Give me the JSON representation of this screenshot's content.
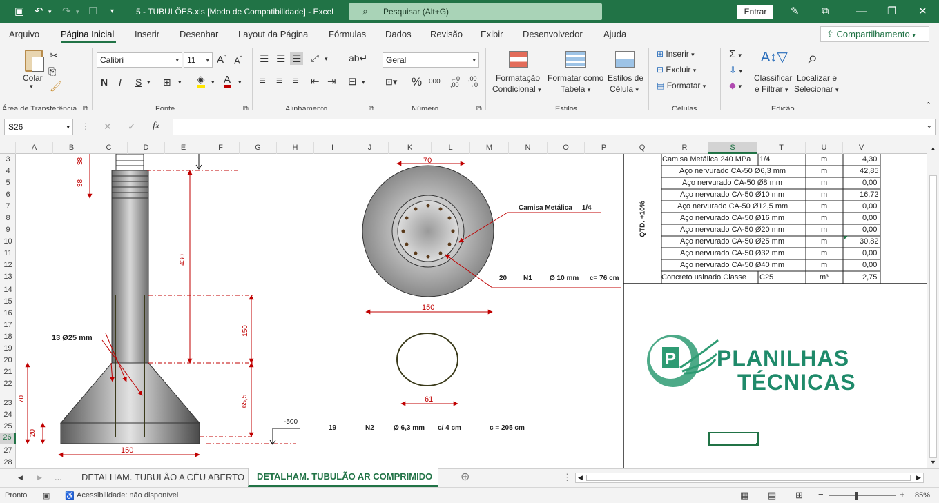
{
  "titlebar": {
    "title": "5 - TUBULÕES.xls  [Modo de Compatibilidade]  -  Excel",
    "search": "Pesquisar (Alt+G)",
    "signin": "Entrar"
  },
  "menu": {
    "tabs": [
      "Arquivo",
      "Página Inicial",
      "Inserir",
      "Desenhar",
      "Layout da Página",
      "Fórmulas",
      "Dados",
      "Revisão",
      "Exibir",
      "Desenvolvedor",
      "Ajuda"
    ],
    "active": "Página Inicial",
    "share": "Compartilhamento"
  },
  "ribbon": {
    "clipboard": {
      "paste": "Colar",
      "group": "Área de Transferência"
    },
    "font": {
      "name": "Calibri",
      "size": "11",
      "group": "Fonte",
      "bold": "N",
      "italic": "I",
      "underline": "S"
    },
    "alignment": {
      "group": "Alinhamento"
    },
    "number": {
      "format": "Geral",
      "group": "Número",
      "percent": "%",
      "thousands": "000"
    },
    "styles": {
      "cond1": "Formatação",
      "cond2": "Condicional",
      "table1": "Formatar como",
      "table2": "Tabela",
      "cell1": "Estilos de",
      "cell2": "Célula",
      "group": "Estilos"
    },
    "cells": {
      "insert": "Inserir",
      "delete": "Excluir",
      "format": "Formatar",
      "group": "Células"
    },
    "editing": {
      "sort1": "Classificar",
      "sort2": "e Filtrar",
      "find1": "Localizar e",
      "find2": "Selecionar",
      "group": "Edição"
    }
  },
  "formula_bar": {
    "namebox": "S26",
    "fx": "fx",
    "value": ""
  },
  "columns": [
    "A",
    "B",
    "C",
    "D",
    "E",
    "F",
    "G",
    "H",
    "I",
    "J",
    "K",
    "L",
    "M",
    "N",
    "O",
    "P",
    "Q",
    "R",
    "S",
    "T",
    "U",
    "V"
  ],
  "rows": [
    "3",
    "4",
    "5",
    "6",
    "7",
    "8",
    "9",
    "10",
    "11",
    "12",
    "13",
    "14",
    "15",
    "16",
    "17",
    "18",
    "19",
    "20",
    "21",
    "22",
    "23",
    "24",
    "25",
    "26",
    "27",
    "28"
  ],
  "drawing": {
    "dims": {
      "d38a": "38",
      "d38b": "38",
      "d430": "430",
      "d150v": "150",
      "d655": "65,5",
      "d70": "70",
      "d20": "20",
      "d150base": "150",
      "elev": "-500"
    },
    "bars_label": "13 Ø25 mm",
    "section": {
      "d70": "70",
      "d150": "150",
      "camisa": "Camisa Metálica     1/4",
      "n1_qty": "20",
      "n1": "N1",
      "n1_dia": "Ø 10 mm",
      "n1_len": "c= 76 cm"
    },
    "stirrup": {
      "d61": "61",
      "n2_qty": "19",
      "n2": "N2",
      "n2_dia": "Ø 6,3 mm",
      "n2_spacing": "c/ 4 cm",
      "n2_len": "c = 205 cm"
    }
  },
  "table": {
    "side_label": "QTD. +10%",
    "rows": [
      {
        "desc": "Camisa Metálica 240 MPa",
        "extra": "1/4",
        "unit": "m",
        "value": "4,30"
      },
      {
        "desc": "Aço nervurado CA-50 Ø6,3 mm",
        "extra": "",
        "unit": "m",
        "value": "42,85"
      },
      {
        "desc": "Aço nervurado CA-50 Ø8 mm",
        "extra": "",
        "unit": "m",
        "value": "0,00"
      },
      {
        "desc": "Aço nervurado CA-50 Ø10 mm",
        "extra": "",
        "unit": "m",
        "value": "16,72"
      },
      {
        "desc": "Aço nervurado CA-50 Ø12,5 mm",
        "extra": "",
        "unit": "m",
        "value": "0,00"
      },
      {
        "desc": "Aço nervurado CA-50 Ø16 mm",
        "extra": "",
        "unit": "m",
        "value": "0,00"
      },
      {
        "desc": "Aço nervurado CA-50 Ø20 mm",
        "extra": "",
        "unit": "m",
        "value": "0,00"
      },
      {
        "desc": "Aço nervurado CA-50 Ø25 mm",
        "extra": "",
        "unit": "m",
        "value": "30,82"
      },
      {
        "desc": "Aço nervurado CA-50 Ø32 mm",
        "extra": "",
        "unit": "m",
        "value": "0,00"
      },
      {
        "desc": "Aço nervurado CA-50 Ø40 mm",
        "extra": "",
        "unit": "m",
        "value": "0,00"
      },
      {
        "desc": "Concreto usinado Classe",
        "extra": "C25",
        "unit": "m³",
        "value": "2,75"
      }
    ]
  },
  "logo": {
    "line1": "PLANILHAS",
    "line2": "TÉCNICAS"
  },
  "sheet_tabs": {
    "more": "...",
    "tab1": "DETALHAM. TUBULÃO A CÉU ABERTO",
    "tab2": "DETALHAM. TUBULÃO AR COMPRIMIDO"
  },
  "status": {
    "ready": "Pronto",
    "accessibility": "Acessibilidade: não disponível",
    "zoom": "85%"
  },
  "colors": {
    "excel_green": "#217346",
    "dim_red": "#c00000",
    "logo_green": "#1f8a6a"
  }
}
